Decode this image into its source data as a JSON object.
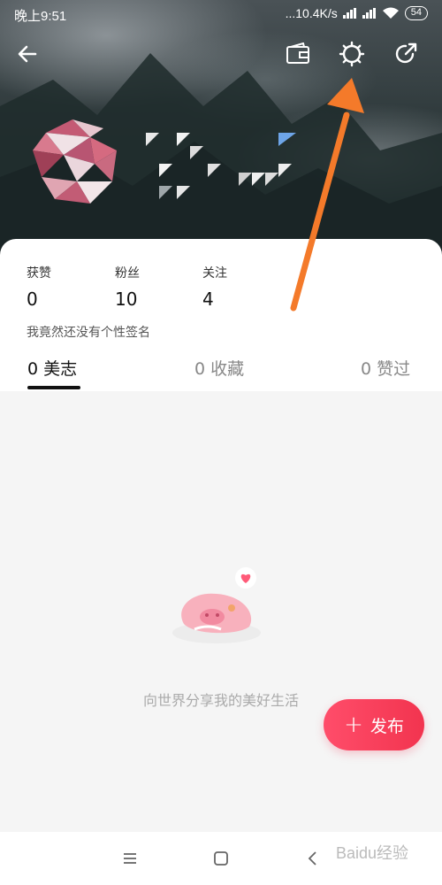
{
  "status_bar": {
    "time": "晚上9:51",
    "network_speed": "...10.4K/s",
    "battery": "54"
  },
  "top_bar": {
    "icons": [
      "back-arrow-icon",
      "wallet-icon",
      "settings-gear-icon",
      "share-icon"
    ]
  },
  "stats": [
    {
      "label": "获赞",
      "value": "0"
    },
    {
      "label": "粉丝",
      "value": "10"
    },
    {
      "label": "关注",
      "value": "4"
    }
  ],
  "bio": "我竟然还没有个性签名",
  "tabs": [
    {
      "label": "0 美志",
      "active": true
    },
    {
      "label": "0 收藏",
      "active": false
    },
    {
      "label": "0 赞过",
      "active": false
    }
  ],
  "empty_state": {
    "message": "向世界分享我的美好生活"
  },
  "publish_button": {
    "plus": "+",
    "label": "发布"
  },
  "watermark": "Baidu经验",
  "colors": {
    "accent": "#f2344f",
    "annotation_arrow": "#f47a2a"
  }
}
